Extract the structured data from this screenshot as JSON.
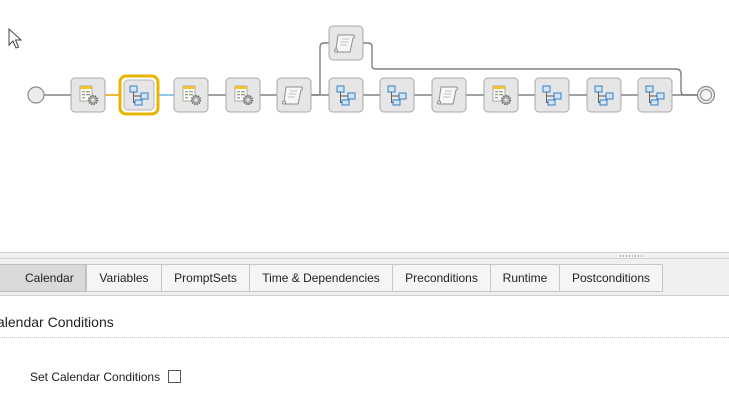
{
  "workflow": {
    "start_node": "start-circle",
    "end_node": "end-circle",
    "main_tasks": [
      {
        "name": "task-node-1",
        "icon": "job-settings-icon",
        "selected": false
      },
      {
        "name": "task-node-2",
        "icon": "workflow-tree-icon",
        "selected": true
      },
      {
        "name": "task-node-3",
        "icon": "job-settings-icon",
        "selected": false
      },
      {
        "name": "task-node-4",
        "icon": "job-settings-icon",
        "selected": false
      },
      {
        "name": "task-node-5",
        "icon": "script-scroll-icon",
        "selected": false
      },
      {
        "name": "task-node-6",
        "icon": "workflow-tree-icon",
        "selected": false
      },
      {
        "name": "task-node-7",
        "icon": "workflow-tree-icon",
        "selected": false
      },
      {
        "name": "task-node-8",
        "icon": "script-scroll-icon",
        "selected": false
      },
      {
        "name": "task-node-9",
        "icon": "job-settings-icon",
        "selected": false
      },
      {
        "name": "task-node-10",
        "icon": "workflow-tree-icon",
        "selected": false
      },
      {
        "name": "task-node-11",
        "icon": "workflow-tree-icon",
        "selected": false
      },
      {
        "name": "task-node-12",
        "icon": "workflow-tree-icon",
        "selected": false
      }
    ],
    "branch_task": {
      "name": "branch-task-node",
      "icon": "script-scroll-icon"
    },
    "colors": {
      "line": "#808080",
      "selected_border": "#e8b400",
      "selected_link": "#f0a000",
      "highlight_link": "#6cb3e6",
      "node_fill": "#e6e6e6"
    }
  },
  "tabs": [
    {
      "label": "Calendar",
      "active": true
    },
    {
      "label": "Variables",
      "active": false
    },
    {
      "label": "PromptSets",
      "active": false
    },
    {
      "label": "Time & Dependencies",
      "active": false
    },
    {
      "label": "Preconditions",
      "active": false
    },
    {
      "label": "Runtime",
      "active": false
    },
    {
      "label": "Postconditions",
      "active": false
    }
  ],
  "section": {
    "title": "alendar Conditions",
    "field_label": "Set Calendar Conditions",
    "field_checked": false
  }
}
